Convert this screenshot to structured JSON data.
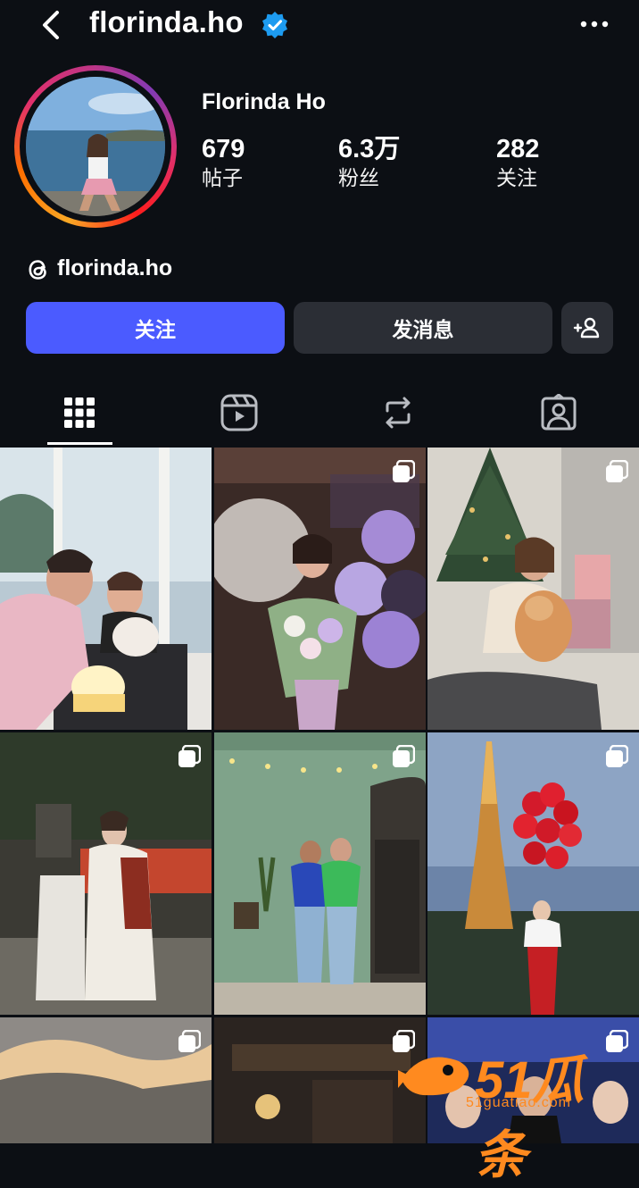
{
  "header": {
    "username": "florinda.ho",
    "verified_color": "#1d9bf0"
  },
  "profile": {
    "display_name": "Florinda Ho",
    "stats": [
      {
        "value": "679",
        "label": "帖子"
      },
      {
        "value": "6.3万",
        "label": "粉丝"
      },
      {
        "value": "282",
        "label": "关注"
      }
    ],
    "threads_handle": "florinda.ho"
  },
  "actions": {
    "follow_label": "关注",
    "message_label": "发消息",
    "follow_color": "#4b5bff"
  },
  "tabs": [
    {
      "icon": "grid-icon",
      "selected": true
    },
    {
      "icon": "reels-icon",
      "selected": false
    },
    {
      "icon": "reposts-icon",
      "selected": false
    },
    {
      "icon": "tagged-icon",
      "selected": false
    }
  ],
  "posts": [
    {
      "multi": false
    },
    {
      "multi": true
    },
    {
      "multi": true
    },
    {
      "multi": true
    },
    {
      "multi": true
    },
    {
      "multi": true
    },
    {
      "multi": true
    },
    {
      "multi": true
    },
    {
      "multi": true
    }
  ],
  "watermark": {
    "text": "51瓜条",
    "sub": "51guatiao.com"
  }
}
